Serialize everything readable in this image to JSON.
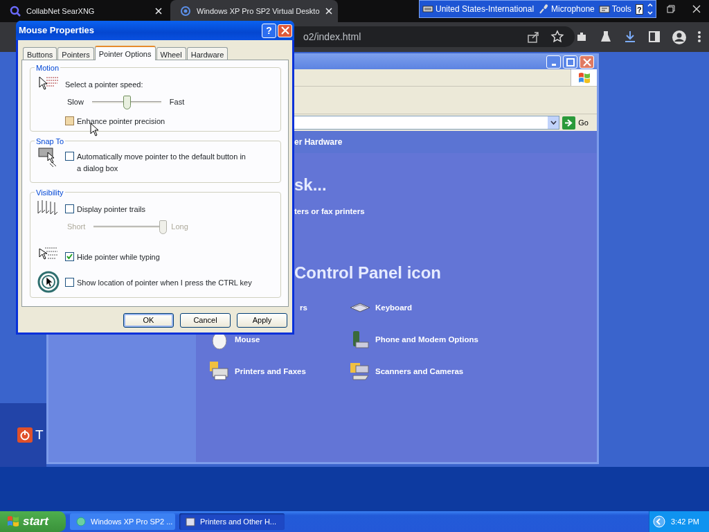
{
  "browser": {
    "tabs": [
      {
        "title": "CollabNet SearXNG",
        "selected": false
      },
      {
        "title": "Windows XP Pro SP2 Virtual Deskto",
        "selected": true
      }
    ],
    "url": "o2/index.html"
  },
  "language_bar": {
    "items": [
      {
        "kind": "keyboard",
        "label": "United States-International"
      },
      {
        "kind": "microphone",
        "label": "Microphone"
      },
      {
        "kind": "tools",
        "label": "Tools"
      }
    ],
    "help": "?"
  },
  "desktop": {
    "turn_off": "T"
  },
  "explorer": {
    "go": "Go",
    "header": "er Hardware",
    "task_heading": "sk...",
    "task_link": "ters or fax printers",
    "icon_heading": "Control Panel icon",
    "items": [
      {
        "kind": "none",
        "label": "rs"
      },
      {
        "kind": "keyboard",
        "label": "Keyboard"
      },
      {
        "kind": "mouse",
        "label": "Mouse"
      },
      {
        "kind": "phone",
        "label": "Phone and Modem Options"
      },
      {
        "kind": "printer",
        "label": "Printers and Faxes"
      },
      {
        "kind": "scanner",
        "label": "Scanners and Cameras"
      }
    ]
  },
  "dialog": {
    "title": "Mouse Properties",
    "help": "?",
    "tabs": [
      {
        "label": "Buttons",
        "selected": false
      },
      {
        "label": "Pointers",
        "selected": false
      },
      {
        "label": "Pointer Options",
        "selected": true
      },
      {
        "label": "Wheel",
        "selected": false
      },
      {
        "label": "Hardware",
        "selected": false
      }
    ],
    "motion": {
      "legend": "Motion",
      "speed_label": "Select a pointer speed:",
      "slow": "Slow",
      "fast": "Fast",
      "speed": {
        "level": 0.5,
        "disabled": false
      },
      "enhance": {
        "label": "Enhance pointer precision",
        "checked": false
      }
    },
    "snap_to": {
      "legend": "Snap To",
      "option": {
        "label": "Automatically move pointer to the default button in a dialog box",
        "checked": false
      }
    },
    "visibility": {
      "legend": "Visibility",
      "trails": {
        "label": "Display pointer trails",
        "checked": false
      },
      "short": "Short",
      "long": "Long",
      "trail_length": {
        "level": 1,
        "disabled": true
      },
      "hide": {
        "label": "Hide pointer while typing",
        "checked": true
      },
      "locate": {
        "label": "Show location of pointer when I press the CTRL key",
        "checked": false
      }
    },
    "buttons": [
      {
        "label": "OK",
        "default": true
      },
      {
        "label": "Cancel",
        "default": false
      },
      {
        "label": "Apply",
        "default": false
      }
    ]
  },
  "taskbar": {
    "start": "start",
    "tasks": [
      {
        "label": "Windows XP Pro SP2 ...",
        "selected": false
      },
      {
        "label": "Printers and Other H...",
        "selected": true
      }
    ],
    "clock": "3:42 PM"
  }
}
